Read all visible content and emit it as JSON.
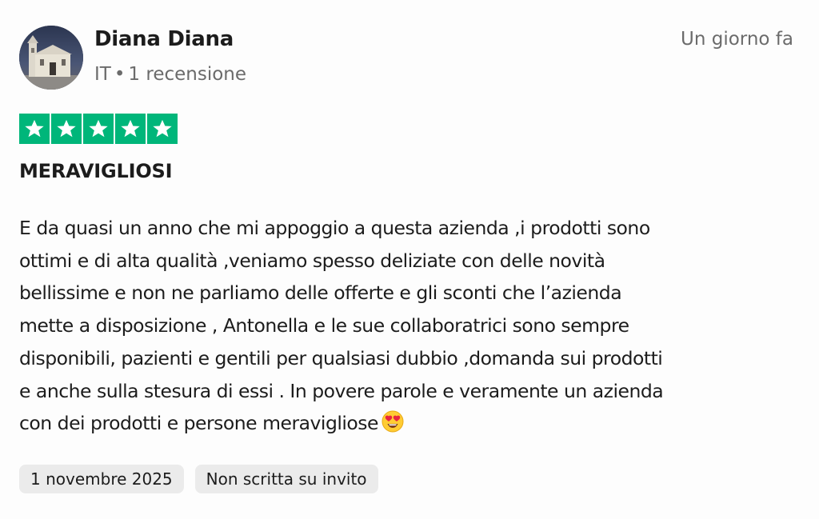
{
  "reviewer": {
    "name": "Diana Diana",
    "country": "IT",
    "separator": "•",
    "review_count": "1 recensione",
    "avatar_icon": "church-photo-avatar"
  },
  "review": {
    "date_relative": "Un giorno fa",
    "rating": 5,
    "rating_max": 5,
    "star_color": "#00b67a",
    "title": "MERAVIGLIOSI",
    "body_lines": [
      "E da quasi un anno che mi appoggio a questa azienda ,i prodotti sono",
      "ottimi e di alta qualità ,veniamo spesso deliziate con delle novità",
      "bellissime e non ne parliamo delle offerte e gli sconti che l’azienda",
      "mette a disposizione , Antonella e le sue collaboratrici sono sempre",
      "disponibili, pazienti e gentili per qualsiasi dubbio ,domanda sui prodotti",
      "e anche sulla stesura di essi . In povere parole e veramente un azienda",
      "con dei prodotti e persone meravigliose"
    ],
    "emoji": "heart-eyes-emoji"
  },
  "tags": {
    "date": "1 novembre 2025",
    "invite_status": "Non scritta su invito"
  }
}
